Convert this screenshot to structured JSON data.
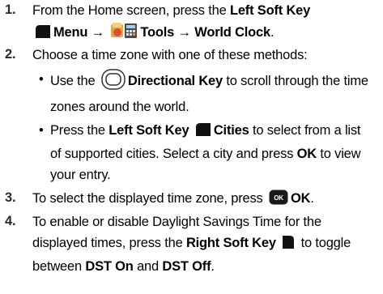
{
  "steps": [
    {
      "num": "1.",
      "line1_pre": "From the Home screen, press the ",
      "line1_bold": "Left Soft Key",
      "line2_menu": "Menu",
      "line2_arrow1": "→",
      "line2_tools": "Tools",
      "line2_arrow2": "→",
      "line2_clock": "World Clock",
      "line2_end": "."
    },
    {
      "num": "2.",
      "text": "Choose a time zone with one of these methods:",
      "bullets": [
        {
          "mark": "•",
          "l1_pre": "Use the",
          "l1_bold": "Directional Key",
          "l1_post": "to scroll through the time",
          "l2": "zones around the world."
        },
        {
          "mark": "•",
          "l1_pre": "Press the ",
          "l1_bold": "Left Soft Key",
          "l1_bold2": "Cities",
          "l1_post": " to select from a list",
          "l2_pre": "of supported cities. Select a city and press ",
          "l2_bold": "OK",
          "l2_post": " to view",
          "l3": "your entry."
        }
      ]
    },
    {
      "num": "3.",
      "pre": "To select the displayed time zone, press",
      "key": "OK",
      "bold": "OK",
      "end": "."
    },
    {
      "num": "4.",
      "l1": "To enable or disable Daylight Savings Time for the",
      "l2_pre": "displayed times, press the ",
      "l2_bold": "Right Soft Key",
      "l2_post": " to toggle",
      "l3_pre": "between ",
      "l3_b1": "DST On",
      "l3_mid": " and ",
      "l3_b2": "DST Off",
      "l3_end": "."
    }
  ]
}
